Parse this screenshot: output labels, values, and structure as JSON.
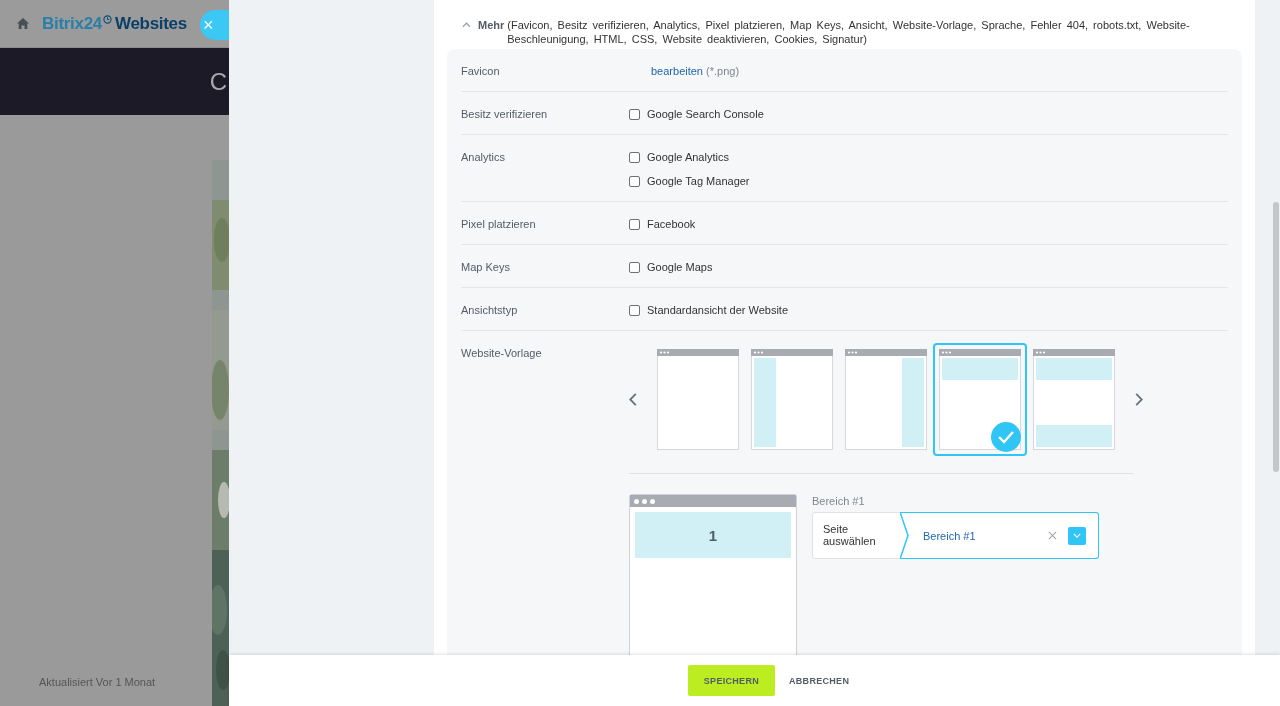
{
  "background": {
    "logo": "Bitrix24",
    "logo_suffix": "Websites",
    "banner_text": "C",
    "updated": "Aktualisiert Vor 1 Monat",
    "close": "×"
  },
  "more": {
    "label": "Mehr",
    "summary": "(Favicon, Besitz verifizieren, Analytics, Pixel platzieren, Map Keys, Ansicht, Website-Vorlage, Sprache, Fehler 404, robots.txt, Website-Beschleunigung, HTML, CSS, Website deaktivieren, Cookies, Signatur)",
    "expanded": true
  },
  "rows": [
    {
      "kind": "link",
      "label": "Favicon",
      "link": "bearbeiten",
      "note": "(*.png)"
    },
    {
      "kind": "checkboxes",
      "label": "Besitz verifizieren",
      "options": [
        {
          "label": "Google Search Console",
          "checked": false
        }
      ]
    },
    {
      "kind": "checkboxes",
      "label": "Analytics",
      "options": [
        {
          "label": "Google Analytics",
          "checked": false
        },
        {
          "label": "Google Tag Manager",
          "checked": false
        }
      ]
    },
    {
      "kind": "checkboxes",
      "label": "Pixel platzieren",
      "options": [
        {
          "label": "Facebook",
          "checked": false
        }
      ]
    },
    {
      "kind": "checkboxes",
      "label": "Map Keys",
      "options": [
        {
          "label": "Google Maps",
          "checked": false
        }
      ]
    },
    {
      "kind": "checkboxes",
      "label": "Ansichtstyp",
      "options": [
        {
          "label": "Standardansicht der Website",
          "checked": false
        }
      ]
    },
    {
      "kind": "templates",
      "label": "Website-Vorlage",
      "templates": [
        {
          "kind": "plain",
          "selected": false
        },
        {
          "kind": "left",
          "selected": false
        },
        {
          "kind": "right",
          "selected": false
        },
        {
          "kind": "top",
          "selected": true
        },
        {
          "kind": "top-bottom",
          "selected": false
        }
      ],
      "preview": {
        "area_number": "1",
        "area_title": "Bereich #1",
        "page_label": "Seite auswählen",
        "value": "Bereich #1"
      }
    }
  ],
  "buttons": [
    {
      "kind": "primary",
      "label": "SPEICHERN"
    },
    {
      "kind": "link",
      "label": "ABBRECHEN"
    }
  ]
}
